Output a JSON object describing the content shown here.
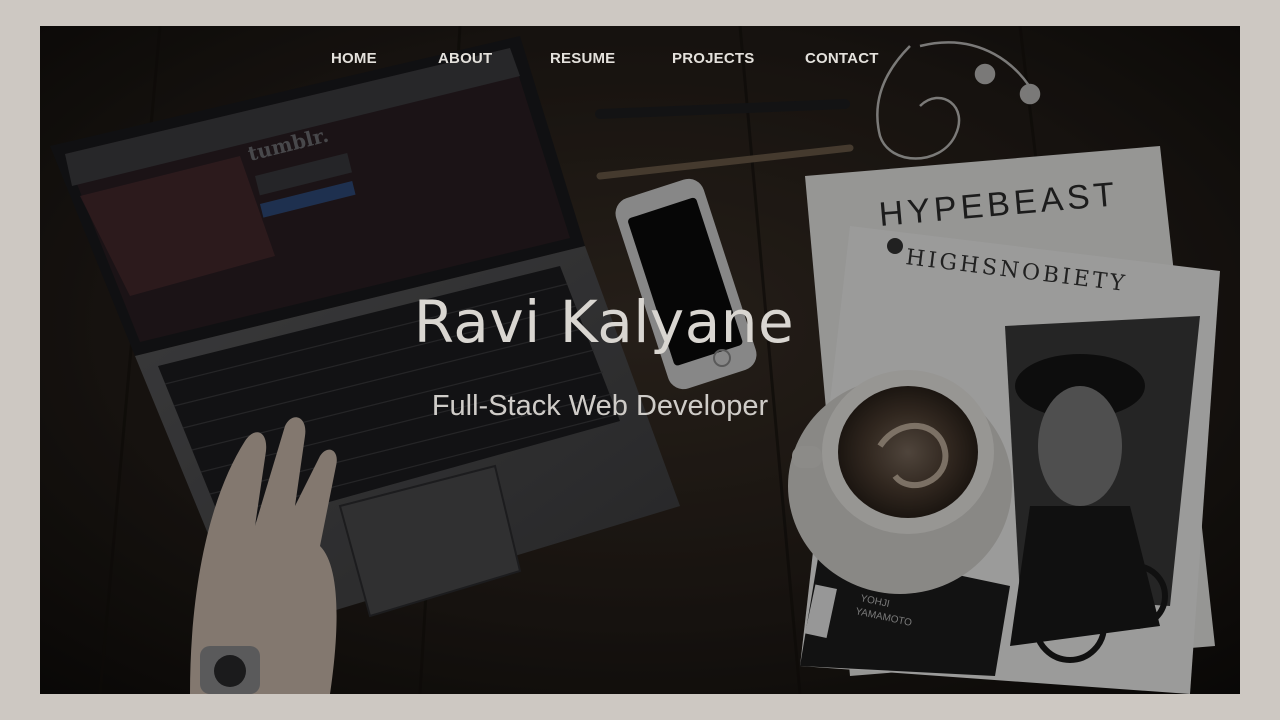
{
  "nav": {
    "items": [
      {
        "label": "HOME"
      },
      {
        "label": "ABOUT"
      },
      {
        "label": "RESUME"
      },
      {
        "label": "PROJECTS"
      },
      {
        "label": "CONTACT"
      }
    ]
  },
  "hero": {
    "name": "Ravi Kalyane",
    "role": "Full-Stack Web Developer",
    "photo_text": {
      "laptop_screen": "tumblr.",
      "magazine_1": "HYPEBEAST",
      "magazine_2": "HIGHSNOBIETY",
      "magazine_cover_name": "YOHJI YAMAMOTO"
    }
  },
  "colors": {
    "page_border": "#cdc8c2",
    "nav_text": "#e4e1dc",
    "hero_text": "#d9d6d1"
  }
}
